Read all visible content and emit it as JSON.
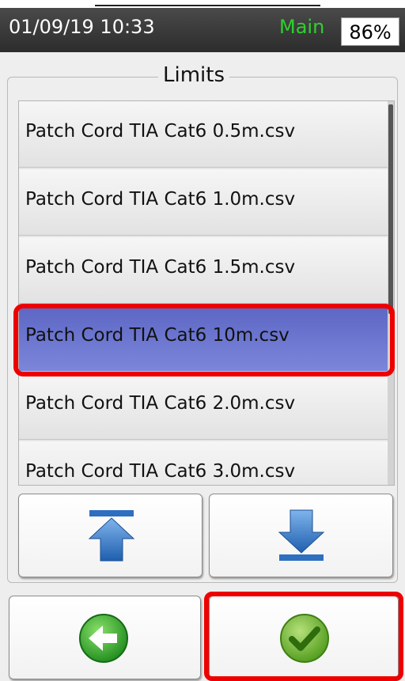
{
  "status_bar": {
    "datetime": "01/09/19 10:33",
    "mode": "Main",
    "battery": "86%"
  },
  "panel": {
    "title": "Limits"
  },
  "files": [
    "Patch Cord TIA Cat6 0.5m.csv",
    "Patch Cord TIA Cat6 1.0m.csv",
    "Patch Cord TIA Cat6 1.5m.csv",
    "Patch Cord TIA Cat6 10m.csv",
    "Patch Cord TIA Cat6 2.0m.csv",
    "Patch Cord TIA Cat6 3.0m.csv"
  ],
  "selected_file_index": 3,
  "colors": {
    "selected_row": "#6b76d0",
    "highlight": "#ee0000",
    "mode_text": "#2ed12e",
    "arrow_blue": "#2f6fc0"
  },
  "icons": {
    "scroll_top": "arrow-to-top-icon",
    "scroll_bottom": "arrow-to-bottom-icon",
    "back": "green-back-arrow-icon",
    "confirm": "green-checkmark-icon"
  }
}
